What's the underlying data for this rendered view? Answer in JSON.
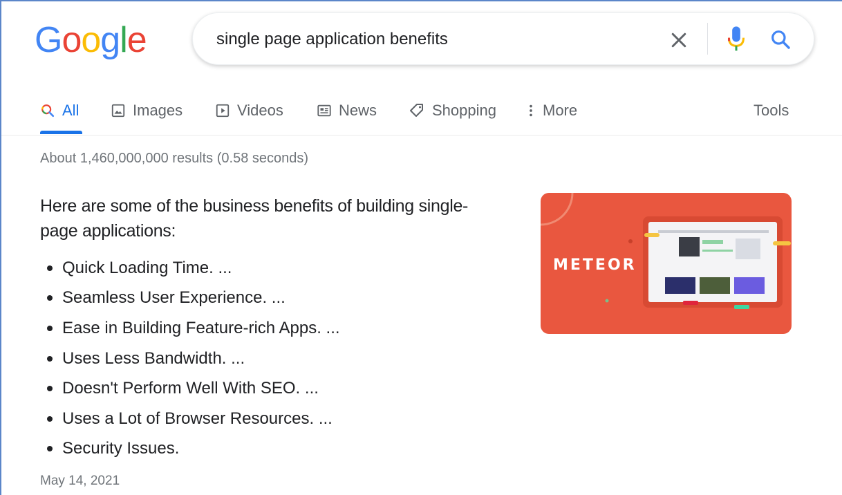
{
  "logo": {
    "text": "Google",
    "letters": [
      {
        "ch": "G",
        "color": "#4285f4"
      },
      {
        "ch": "o",
        "color": "#ea4335"
      },
      {
        "ch": "o",
        "color": "#fbbc05"
      },
      {
        "ch": "g",
        "color": "#4285f4"
      },
      {
        "ch": "l",
        "color": "#34a853"
      },
      {
        "ch": "e",
        "color": "#ea4335"
      }
    ]
  },
  "search": {
    "value": "single page application benefits"
  },
  "tabs": [
    {
      "label": "All",
      "icon": "search-icon",
      "active": true
    },
    {
      "label": "Images",
      "icon": "image-icon",
      "active": false
    },
    {
      "label": "Videos",
      "icon": "play-icon",
      "active": false
    },
    {
      "label": "News",
      "icon": "newspaper-icon",
      "active": false
    },
    {
      "label": "Shopping",
      "icon": "tag-icon",
      "active": false
    },
    {
      "label": "More",
      "icon": "more-vert-icon",
      "active": false
    }
  ],
  "tools_label": "Tools",
  "result_stats": "About 1,460,000,000 results (0.58 seconds)",
  "snippet": {
    "heading_line1": "Here are some of the business benefits of building single-",
    "heading_line2": "page applications:",
    "items": [
      "Quick Loading Time. ...",
      "Seamless User Experience. ...",
      "Ease in Building Feature-rich Apps. ...",
      "Uses Less Bandwidth. ...",
      "Doesn't Perform Well With SEO. ...",
      "Uses a Lot of Browser Resources. ...",
      "Security Issues."
    ],
    "date": "May 14, 2021"
  },
  "thumbnail": {
    "brand": "METEOR",
    "bg_color": "#e9573f"
  },
  "colors": {
    "accent": "#1a73e8",
    "muted": "#70757a",
    "tab_text": "#5f6368"
  }
}
